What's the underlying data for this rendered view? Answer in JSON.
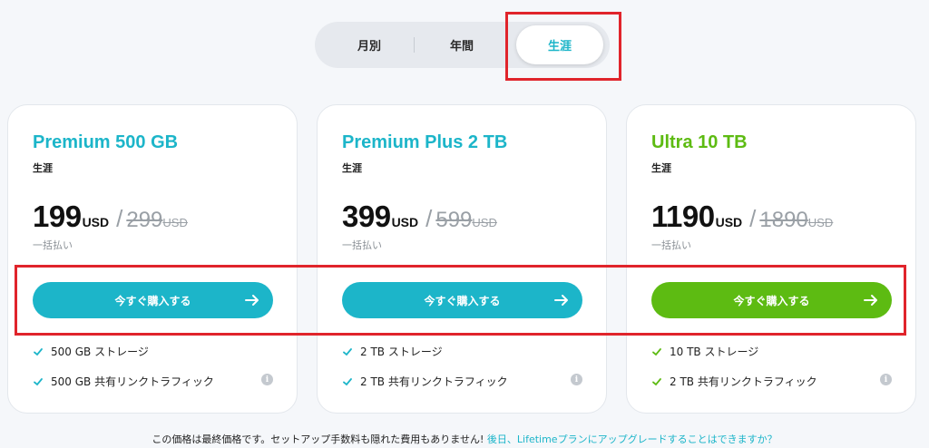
{
  "toggle": {
    "monthly": "月別",
    "yearly": "年間",
    "lifetime": "生涯"
  },
  "plans": [
    {
      "name": "Premium 500 GB",
      "sub": "生涯",
      "price": "199",
      "currency": "USD",
      "old_price": "299",
      "old_currency": "USD",
      "note": "一括払い",
      "button": "今すぐ購入する",
      "features": [
        "500 GB ストレージ",
        "500 GB 共有リンクトラフィック"
      ],
      "accent": "#1cb5c9"
    },
    {
      "name": "Premium Plus 2 TB",
      "sub": "生涯",
      "price": "399",
      "currency": "USD",
      "old_price": "599",
      "old_currency": "USD",
      "note": "一括払い",
      "button": "今すぐ購入する",
      "features": [
        "2 TB ストレージ",
        "2 TB 共有リンクトラフィック"
      ],
      "accent": "#1cb5c9"
    },
    {
      "name": "Ultra 10 TB",
      "sub": "生涯",
      "price": "1190",
      "currency": "USD",
      "old_price": "1890",
      "old_currency": "USD",
      "note": "一括払い",
      "button": "今すぐ購入する",
      "features": [
        "10 TB ストレージ",
        "2 TB 共有リンクトラフィック"
      ],
      "accent": "#5dbb12"
    }
  ],
  "footer": {
    "text": "この価格は最終価格です。セットアップ手数料も隠れた費用もありません! ",
    "link": "後日、Lifetimeプランにアップグレードすることはできますか？"
  },
  "icons": {
    "check": "check-icon",
    "arrow": "arrow-right-icon",
    "info": "info-icon"
  }
}
